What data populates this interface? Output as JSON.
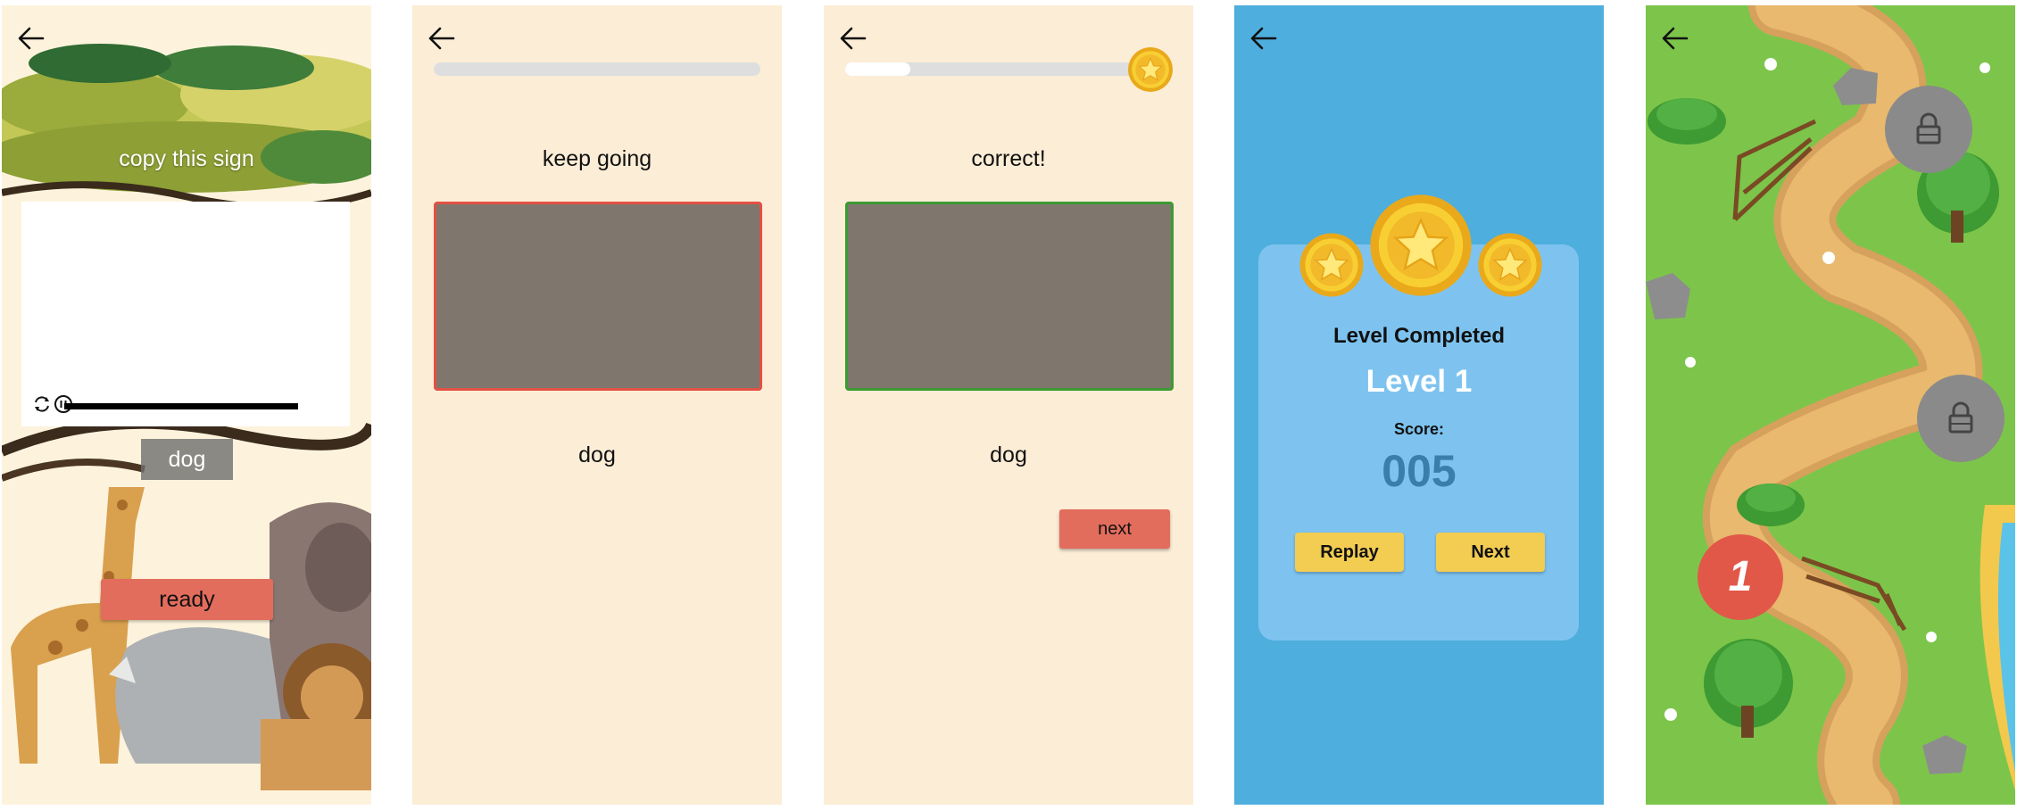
{
  "screens": {
    "video": {
      "back_icon": "arrow-left-icon",
      "prompt": "copy this sign",
      "word": "dog",
      "ready_label": "ready",
      "controls": {
        "replay_icon": "replay-icon",
        "pause_icon": "pause-icon"
      }
    },
    "attempt": {
      "back_icon": "arrow-left-icon",
      "message": "keep going",
      "word": "dog",
      "progress": 0
    },
    "correct": {
      "back_icon": "arrow-left-icon",
      "message": "correct!",
      "word": "dog",
      "next_label": "next",
      "progress": 0.2,
      "coin_icon": "star-coin-icon"
    },
    "level_complete": {
      "back_icon": "arrow-left-icon",
      "heading": "Level Completed",
      "level": "Level 1",
      "score_label": "Score:",
      "score": "005",
      "replay_label": "Replay",
      "next_label": "Next",
      "stars": 3
    },
    "map": {
      "back_icon": "arrow-left-icon",
      "current_level": "1",
      "locked_levels": 2
    }
  },
  "colors": {
    "beige": "#fcedd6",
    "accent_red": "#e36d5d",
    "sky_blue": "#4eaedd",
    "card_blue": "#7ec3ef",
    "button_yellow": "#f3cc52",
    "score_blue": "#3b7dab",
    "grass": "#7cc54a"
  }
}
